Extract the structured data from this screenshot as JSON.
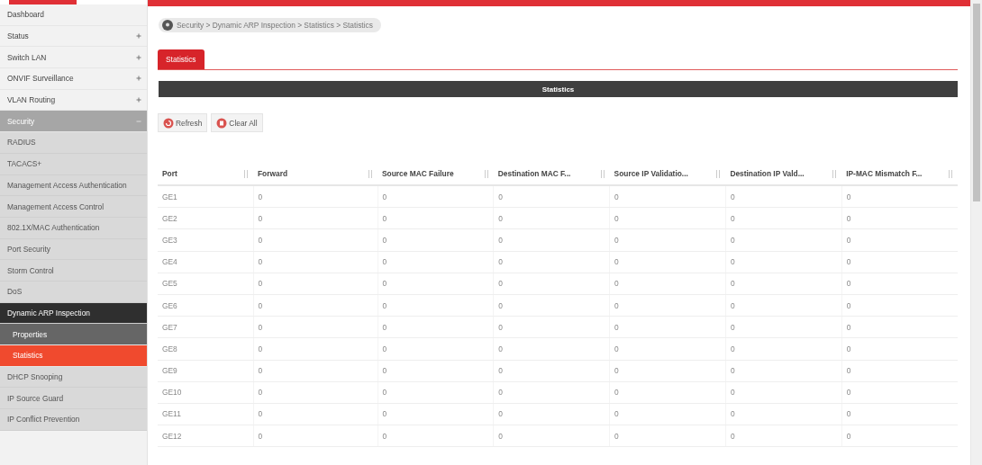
{
  "sidebar": {
    "items": [
      {
        "label": "Dashboard",
        "selected": false
      },
      {
        "label": "Status",
        "expanded": false,
        "selected": false
      },
      {
        "label": "Switch LAN",
        "expanded": false,
        "selected": false
      },
      {
        "label": "ONVIF Surveillance",
        "expanded": false,
        "selected": false
      },
      {
        "label": "VLAN Routing",
        "expanded": false,
        "selected": false
      },
      {
        "label": "Security",
        "expanded": true,
        "selected": true,
        "children": [
          {
            "label": "RADIUS",
            "selected": false
          },
          {
            "label": "TACACS+",
            "selected": false
          },
          {
            "label": "Management Access Authentication",
            "selected": false
          },
          {
            "label": "Management Access Control",
            "selected": false
          },
          {
            "label": "802.1X/MAC Authentication",
            "selected": false
          },
          {
            "label": "Port Security",
            "selected": false
          },
          {
            "label": "Storm Control",
            "selected": false
          },
          {
            "label": "DoS",
            "selected": false
          },
          {
            "label": "Dynamic ARP Inspection",
            "expanded": true,
            "selected": true,
            "children": [
              {
                "label": "Properties",
                "selected": false
              },
              {
                "label": "Statistics",
                "selected": true
              }
            ]
          },
          {
            "label": "DHCP Snooping",
            "selected": false
          },
          {
            "label": "IP Source Guard",
            "selected": false
          },
          {
            "label": "IP Conflict Prevention",
            "selected": false
          }
        ]
      }
    ]
  },
  "breadcrumb": "Security > Dynamic ARP Inspection > Statistics > Statistics",
  "tabs": [
    {
      "label": "Statistics",
      "selected": true
    }
  ],
  "section_title": "Statistics",
  "buttons": [
    {
      "label": "Refresh",
      "kind": "refresh"
    },
    {
      "label": "Clear All",
      "kind": "clear"
    }
  ],
  "table": {
    "columns": [
      "Port",
      "Forward",
      "Source MAC Failure",
      "Destination MAC F...",
      "Source IP Validatio...",
      "Destination IP Vald...",
      "IP-MAC Mismatch F..."
    ],
    "rows": [
      [
        "GE1",
        "0",
        "0",
        "0",
        "0",
        "0",
        "0"
      ],
      [
        "GE2",
        "0",
        "0",
        "0",
        "0",
        "0",
        "0"
      ],
      [
        "GE3",
        "0",
        "0",
        "0",
        "0",
        "0",
        "0"
      ],
      [
        "GE4",
        "0",
        "0",
        "0",
        "0",
        "0",
        "0"
      ],
      [
        "GE5",
        "0",
        "0",
        "0",
        "0",
        "0",
        "0"
      ],
      [
        "GE6",
        "0",
        "0",
        "0",
        "0",
        "0",
        "0"
      ],
      [
        "GE7",
        "0",
        "0",
        "0",
        "0",
        "0",
        "0"
      ],
      [
        "GE8",
        "0",
        "0",
        "0",
        "0",
        "0",
        "0"
      ],
      [
        "GE9",
        "0",
        "0",
        "0",
        "0",
        "0",
        "0"
      ],
      [
        "GE10",
        "0",
        "0",
        "0",
        "0",
        "0",
        "0"
      ],
      [
        "GE11",
        "0",
        "0",
        "0",
        "0",
        "0",
        "0"
      ],
      [
        "GE12",
        "0",
        "0",
        "0",
        "0",
        "0",
        "0"
      ]
    ]
  }
}
